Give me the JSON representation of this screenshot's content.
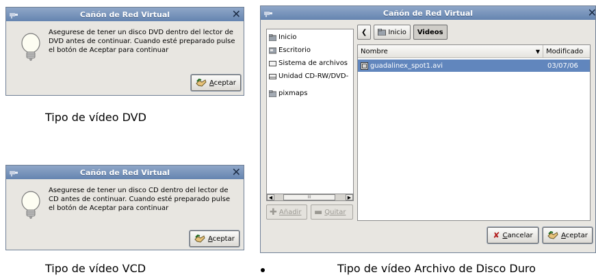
{
  "dialog_title": "Cañón de Red Virtual",
  "dvd_dialog": {
    "message": "Asegurese de tener un disco DVD dentro del lector de DVD antes de continuar. Cuando esté preparado pulse el botón de Aceptar para continuar",
    "accept_mnemonic": "A",
    "accept_rest": "ceptar"
  },
  "vcd_dialog": {
    "message": "Asegurese de tener un disco CD dentro del lector de CD antes de continuar. Cuando esté preparado pulse el botón de Aceptar para continuar",
    "accept_mnemonic": "A",
    "accept_rest": "ceptar"
  },
  "captions": {
    "dvd": "Tipo de vídeo DVD",
    "vcd": "Tipo de vídeo VCD",
    "hdd": "Tipo de vídeo Archivo de Disco Duro"
  },
  "file_chooser": {
    "places": [
      {
        "label": "Inicio",
        "icon": "home-folder-icon"
      },
      {
        "label": "Escritorio",
        "icon": "desktop-icon"
      },
      {
        "label": "Sistema de archivos",
        "icon": "drive-icon"
      },
      {
        "label": "Unidad CD-RW/DVD-",
        "icon": "optical-drive-icon"
      },
      {
        "label": "pixmaps",
        "icon": "folder-icon"
      }
    ],
    "scroll_thumb_label": "III",
    "add_label": "Añadir",
    "remove_label": "Quitar",
    "path_back_icon": "chevron-left-icon",
    "path_buttons": [
      "Inicio",
      "Videos"
    ],
    "columns": {
      "name": "Nombre",
      "modified": "Modificado"
    },
    "files": [
      {
        "name": "guadalinex_spot1.avi",
        "modified": "03/07/06",
        "selected": true
      }
    ],
    "cancel_mnemonic": "C",
    "cancel_rest": "ancelar",
    "accept_mnemonic": "A",
    "accept_rest": "ceptar"
  },
  "colors": {
    "titlebar": "#7a95bd",
    "window_bg": "#e8e6e1",
    "selection": "#6186bd"
  }
}
